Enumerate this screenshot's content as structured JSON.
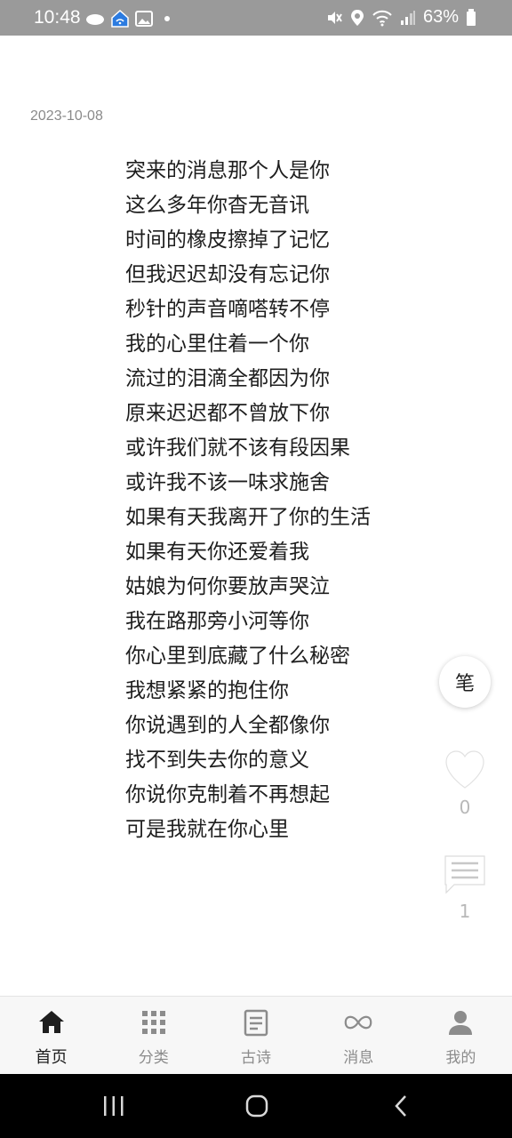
{
  "status_bar": {
    "time": "10:48",
    "battery": "63%",
    "left_icons": [
      "cloud-icon",
      "home-wifi-icon",
      "image-icon",
      "dot-icon"
    ],
    "right_icons": [
      "mute-icon",
      "location-icon",
      "wifi-icon",
      "signal-icon",
      "battery-icon"
    ]
  },
  "post": {
    "date": "2023-10-08",
    "lines": [
      "突来的消息那个人是你",
      "这么多年你杳无音讯",
      "时间的橡皮擦掉了记忆",
      "但我迟迟却没有忘记你",
      "秒针的声音嘀嗒转不停",
      "我的心里住着一个你",
      "流过的泪滴全都因为你",
      "原来迟迟都不曾放下你",
      "或许我们就不该有段因果",
      "或许我不该一味求施舍",
      "如果有天我离开了你的生活",
      "如果有天你还爱着我",
      "姑娘为何你要放声哭泣",
      "我在路那旁小河等你",
      "你心里到底藏了什么秘密",
      "我想紧紧的抱住你",
      "你说遇到的人全都像你",
      "找不到失去你的意义",
      "你说你克制着不再想起",
      "可是我就在你心里"
    ]
  },
  "actions": {
    "pen_label": "笔",
    "like_count": "0",
    "comment_count": "1"
  },
  "bottom_nav": {
    "items": [
      {
        "label": "首页",
        "icon": "home-icon",
        "active": true
      },
      {
        "label": "分类",
        "icon": "grid-icon",
        "active": false
      },
      {
        "label": "古诗",
        "icon": "document-icon",
        "active": false
      },
      {
        "label": "消息",
        "icon": "infinity-icon",
        "active": false
      },
      {
        "label": "我的",
        "icon": "person-icon",
        "active": false
      }
    ]
  },
  "colors": {
    "status_bar": "#9a9a9a",
    "text": "#1e1e1e",
    "muted": "#8c8c8c",
    "nav_bg": "#f7f7f7"
  }
}
